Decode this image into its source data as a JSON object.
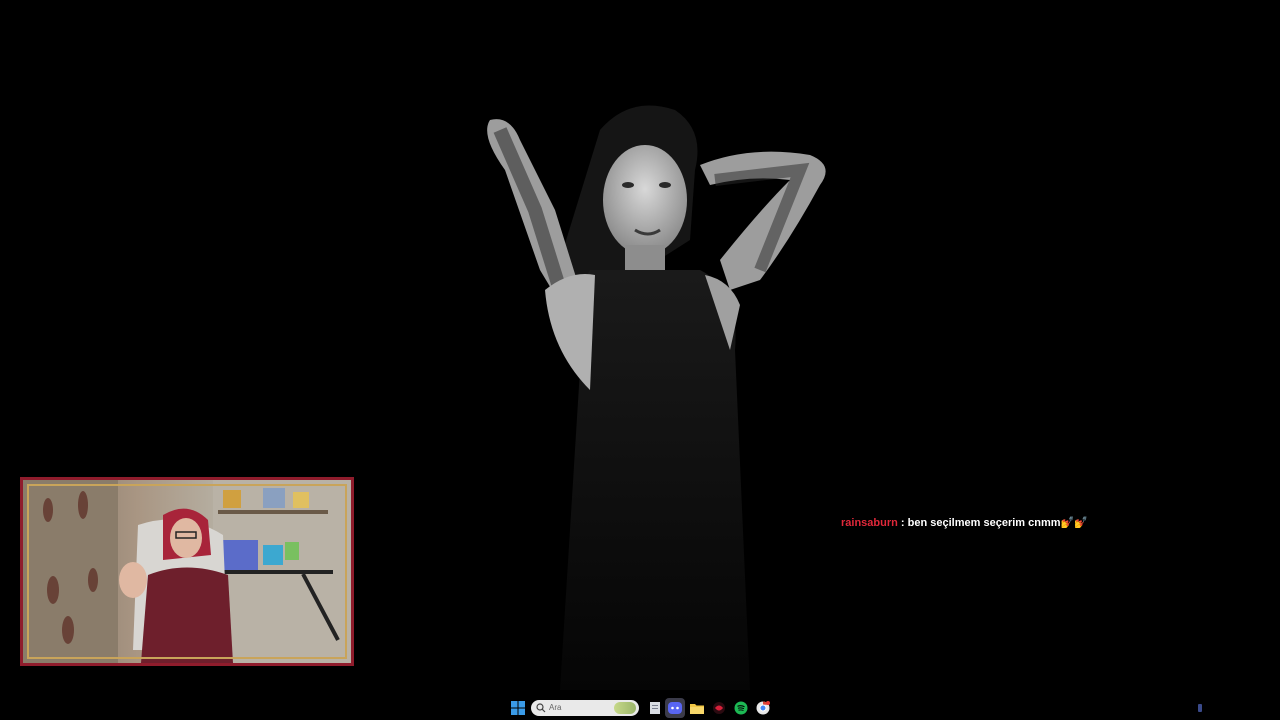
{
  "chat": {
    "username": "rainsaburn",
    "separator": ":",
    "message": "ben seçilmem seçerim cnmm💅💅"
  },
  "taskbar": {
    "search_placeholder": "Ara",
    "icons": [
      "windows-start-icon",
      "search-icon",
      "file-explorer-doc-icon",
      "discord-icon",
      "folder-icon",
      "app-red-icon",
      "spotify-icon",
      "chrome-icon"
    ]
  },
  "colors": {
    "background": "#000000",
    "chat_username": "#e0283a",
    "chat_text": "#ffffff",
    "webcam_frame": "#8f1c2c",
    "webcam_trim": "#c9a45a",
    "windows_blue": "#3a9be8",
    "discord": "#5865f2",
    "spotify": "#1db954"
  }
}
